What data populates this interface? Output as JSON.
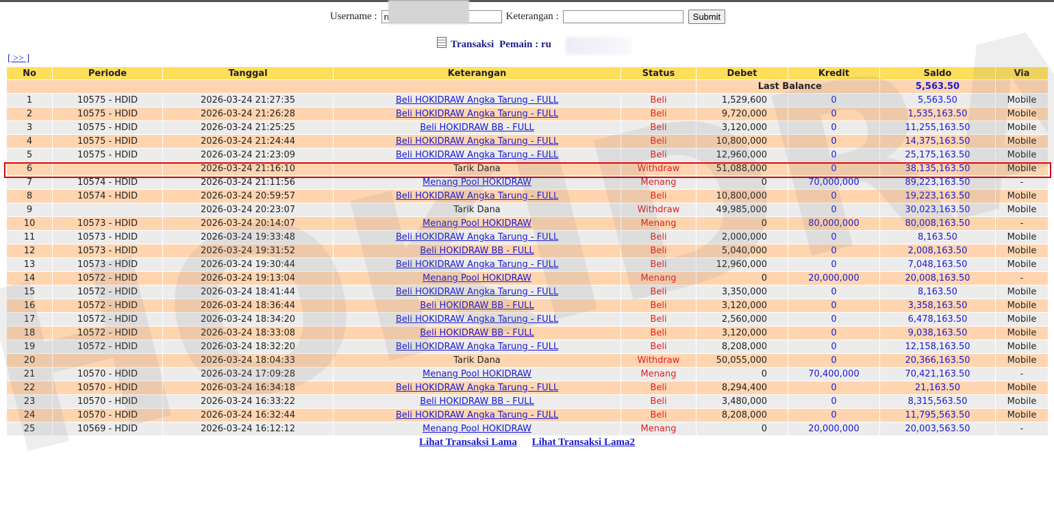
{
  "search": {
    "username_label": "Username :",
    "username_value": "ru",
    "keterangan_label": "Keterangan :",
    "keterangan_value": "",
    "submit_label": "Submit"
  },
  "title": {
    "transaksi": "Transaksi",
    "pemain": "Pemain : ru"
  },
  "nav_next": "[ >> ]",
  "watermark": "HOKIDRAW",
  "table": {
    "headers": [
      "No",
      "Periode",
      "Tanggal",
      "Keterangan",
      "Status",
      "Debet",
      "Kredit",
      "Saldo",
      "Via"
    ],
    "last_balance_label": "Last Balance",
    "last_balance_value": "5,563.50",
    "rows": [
      {
        "no": "1",
        "periode": "10575 - HDID",
        "tanggal": "2026-03-24 21:27:35",
        "ket": "Beli HOKIDRAW Angka Tarung - FULL",
        "link": true,
        "status": "Beli",
        "debet": "1,529,600",
        "kredit": "0",
        "saldo": "5,563.50",
        "via": "Mobile"
      },
      {
        "no": "2",
        "periode": "10575 - HDID",
        "tanggal": "2026-03-24 21:26:28",
        "ket": "Beli HOKIDRAW Angka Tarung - FULL",
        "link": true,
        "status": "Beli",
        "debet": "9,720,000",
        "kredit": "0",
        "saldo": "1,535,163.50",
        "via": "Mobile"
      },
      {
        "no": "3",
        "periode": "10575 - HDID",
        "tanggal": "2026-03-24 21:25:25",
        "ket": "Beli HOKIDRAW BB - FULL",
        "link": true,
        "status": "Beli",
        "debet": "3,120,000",
        "kredit": "0",
        "saldo": "11,255,163.50",
        "via": "Mobile"
      },
      {
        "no": "4",
        "periode": "10575 - HDID",
        "tanggal": "2026-03-24 21:24:44",
        "ket": "Beli HOKIDRAW Angka Tarung - FULL",
        "link": true,
        "status": "Beli",
        "debet": "10,800,000",
        "kredit": "0",
        "saldo": "14,375,163.50",
        "via": "Mobile"
      },
      {
        "no": "5",
        "periode": "10575 - HDID",
        "tanggal": "2026-03-24 21:23:09",
        "ket": "Beli HOKIDRAW Angka Tarung - FULL",
        "link": true,
        "status": "Beli",
        "debet": "12,960,000",
        "kredit": "0",
        "saldo": "25,175,163.50",
        "via": "Mobile"
      },
      {
        "no": "6",
        "periode": "",
        "tanggal": "2026-03-24 21:16:10",
        "ket": "Tarik Dana",
        "link": false,
        "status": "Withdraw",
        "debet": "51,088,000",
        "kredit": "0",
        "saldo": "38,135,163.50",
        "via": "Mobile"
      },
      {
        "no": "7",
        "periode": "10574 - HDID",
        "tanggal": "2026-03-24 21:11:56",
        "ket": "Menang Pool HOKIDRAW",
        "link": true,
        "status": "Menang",
        "debet": "0",
        "kredit": "70,000,000",
        "saldo": "89,223,163.50",
        "via": "-"
      },
      {
        "no": "8",
        "periode": "10574 - HDID",
        "tanggal": "2026-03-24 20:59:57",
        "ket": "Beli HOKIDRAW Angka Tarung - FULL",
        "link": true,
        "status": "Beli",
        "debet": "10,800,000",
        "kredit": "0",
        "saldo": "19,223,163.50",
        "via": "Mobile"
      },
      {
        "no": "9",
        "periode": "",
        "tanggal": "2026-03-24 20:23:07",
        "ket": "Tarik Dana",
        "link": false,
        "status": "Withdraw",
        "debet": "49,985,000",
        "kredit": "0",
        "saldo": "30,023,163.50",
        "via": "Mobile"
      },
      {
        "no": "10",
        "periode": "10573 - HDID",
        "tanggal": "2026-03-24 20:14:07",
        "ket": "Menang Pool HOKIDRAW",
        "link": true,
        "status": "Menang",
        "debet": "0",
        "kredit": "80,000,000",
        "saldo": "80,008,163.50",
        "via": "-"
      },
      {
        "no": "11",
        "periode": "10573 - HDID",
        "tanggal": "2026-03-24 19:33:48",
        "ket": "Beli HOKIDRAW Angka Tarung - FULL",
        "link": true,
        "status": "Beli",
        "debet": "2,000,000",
        "kredit": "0",
        "saldo": "8,163.50",
        "via": "Mobile"
      },
      {
        "no": "12",
        "periode": "10573 - HDID",
        "tanggal": "2026-03-24 19:31:52",
        "ket": "Beli HOKIDRAW BB - FULL",
        "link": true,
        "status": "Beli",
        "debet": "5,040,000",
        "kredit": "0",
        "saldo": "2,008,163.50",
        "via": "Mobile"
      },
      {
        "no": "13",
        "periode": "10573 - HDID",
        "tanggal": "2026-03-24 19:30:44",
        "ket": "Beli HOKIDRAW Angka Tarung - FULL",
        "link": true,
        "status": "Beli",
        "debet": "12,960,000",
        "kredit": "0",
        "saldo": "7,048,163.50",
        "via": "Mobile"
      },
      {
        "no": "14",
        "periode": "10572 - HDID",
        "tanggal": "2026-03-24 19:13:04",
        "ket": "Menang Pool HOKIDRAW",
        "link": true,
        "status": "Menang",
        "debet": "0",
        "kredit": "20,000,000",
        "saldo": "20,008,163.50",
        "via": "-"
      },
      {
        "no": "15",
        "periode": "10572 - HDID",
        "tanggal": "2026-03-24 18:41:44",
        "ket": "Beli HOKIDRAW Angka Tarung - FULL",
        "link": true,
        "status": "Beli",
        "debet": "3,350,000",
        "kredit": "0",
        "saldo": "8,163.50",
        "via": "Mobile"
      },
      {
        "no": "16",
        "periode": "10572 - HDID",
        "tanggal": "2026-03-24 18:36:44",
        "ket": "Beli HOKIDRAW BB - FULL",
        "link": true,
        "status": "Beli",
        "debet": "3,120,000",
        "kredit": "0",
        "saldo": "3,358,163.50",
        "via": "Mobile"
      },
      {
        "no": "17",
        "periode": "10572 - HDID",
        "tanggal": "2026-03-24 18:34:20",
        "ket": "Beli HOKIDRAW Angka Tarung - FULL",
        "link": true,
        "status": "Beli",
        "debet": "2,560,000",
        "kredit": "0",
        "saldo": "6,478,163.50",
        "via": "Mobile"
      },
      {
        "no": "18",
        "periode": "10572 - HDID",
        "tanggal": "2026-03-24 18:33:08",
        "ket": "Beli HOKIDRAW BB - FULL",
        "link": true,
        "status": "Beli",
        "debet": "3,120,000",
        "kredit": "0",
        "saldo": "9,038,163.50",
        "via": "Mobile"
      },
      {
        "no": "19",
        "periode": "10572 - HDID",
        "tanggal": "2026-03-24 18:32:20",
        "ket": "Beli HOKIDRAW Angka Tarung - FULL",
        "link": true,
        "status": "Beli",
        "debet": "8,208,000",
        "kredit": "0",
        "saldo": "12,158,163.50",
        "via": "Mobile"
      },
      {
        "no": "20",
        "periode": "",
        "tanggal": "2026-03-24 18:04:33",
        "ket": "Tarik Dana",
        "link": false,
        "status": "Withdraw",
        "debet": "50,055,000",
        "kredit": "0",
        "saldo": "20,366,163.50",
        "via": "Mobile"
      },
      {
        "no": "21",
        "periode": "10570 - HDID",
        "tanggal": "2026-03-24 17:09:28",
        "ket": "Menang Pool HOKIDRAW",
        "link": true,
        "status": "Menang",
        "debet": "0",
        "kredit": "70,400,000",
        "saldo": "70,421,163.50",
        "via": "-"
      },
      {
        "no": "22",
        "periode": "10570 - HDID",
        "tanggal": "2026-03-24 16:34:18",
        "ket": "Beli HOKIDRAW Angka Tarung - FULL",
        "link": true,
        "status": "Beli",
        "debet": "8,294,400",
        "kredit": "0",
        "saldo": "21,163.50",
        "via": "Mobile"
      },
      {
        "no": "23",
        "periode": "10570 - HDID",
        "tanggal": "2026-03-24 16:33:22",
        "ket": "Beli HOKIDRAW BB - FULL",
        "link": true,
        "status": "Beli",
        "debet": "3,480,000",
        "kredit": "0",
        "saldo": "8,315,563.50",
        "via": "Mobile"
      },
      {
        "no": "24",
        "periode": "10570 - HDID",
        "tanggal": "2026-03-24 16:32:44",
        "ket": "Beli HOKIDRAW Angka Tarung - FULL",
        "link": true,
        "status": "Beli",
        "debet": "8,208,000",
        "kredit": "0",
        "saldo": "11,795,563.50",
        "via": "Mobile"
      },
      {
        "no": "25",
        "periode": "10569 - HDID",
        "tanggal": "2026-03-24 16:12:12",
        "ket": "Menang Pool HOKIDRAW",
        "link": true,
        "status": "Menang",
        "debet": "0",
        "kredit": "20,000,000",
        "saldo": "20,003,563.50",
        "via": "-"
      }
    ]
  },
  "footer": {
    "link1": "Lihat Transaksi Lama",
    "link2": "Lihat Transaksi Lama2"
  },
  "colors": {
    "header_bg": "#ffdf5a",
    "row_peach": "#ffd5b0",
    "row_gray": "#ececec",
    "link_blue": "#1a1ad0",
    "status_red": "#e02020",
    "highlight_red": "#e00000"
  }
}
